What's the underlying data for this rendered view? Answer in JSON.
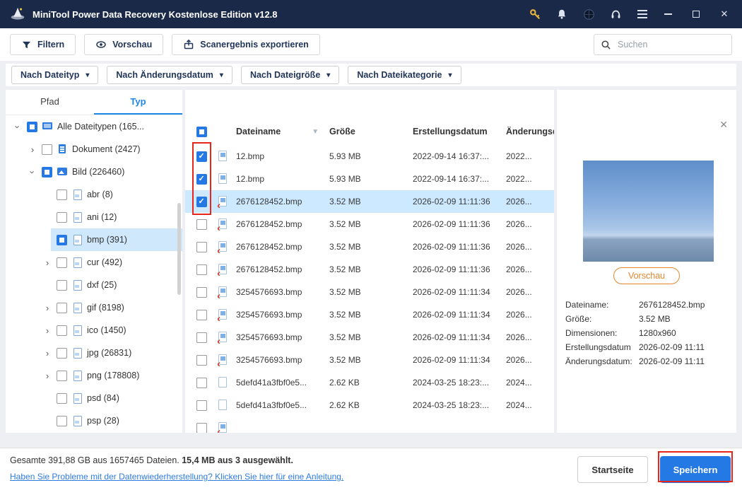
{
  "titlebar": {
    "title": "MiniTool Power Data Recovery Kostenlose Edition v12.8",
    "icons": [
      "key",
      "bell",
      "globe",
      "headset",
      "menu"
    ],
    "window_controls": [
      "minimize",
      "maximize",
      "close"
    ]
  },
  "toolbar": {
    "filtern": "Filtern",
    "vorschau": "Vorschau",
    "export": "Scanergebnis exportieren",
    "search_placeholder": "Suchen"
  },
  "filter_dropdowns": [
    "Nach Dateityp",
    "Nach Änderungsdatum",
    "Nach Dateigröße",
    "Nach Dateikategorie"
  ],
  "glyphs": {
    "caret_down": "▾",
    "sort_down": "▼",
    "close": "✕",
    "chevron": "›",
    "deleted_x": "✕"
  },
  "sidebar": {
    "tabs": [
      "Pfad",
      "Typ"
    ],
    "active_tab": "Typ",
    "tree": [
      {
        "label": "Alle Dateitypen (165...",
        "level": 0,
        "arrow": "down",
        "check": "partial",
        "icon": "all-types",
        "selected": false
      },
      {
        "label": "Dokument (2427)",
        "level": 1,
        "arrow": "right",
        "check": "unchecked",
        "icon": "document",
        "selected": false
      },
      {
        "label": "Bild (226460)",
        "level": 1,
        "arrow": "down",
        "check": "partial",
        "icon": "image",
        "selected": false
      },
      {
        "label": "abr (8)",
        "level": 2,
        "arrow": null,
        "check": "unchecked",
        "icon": "page",
        "selected": false
      },
      {
        "label": "ani (12)",
        "level": 2,
        "arrow": null,
        "check": "unchecked",
        "icon": "page",
        "selected": false
      },
      {
        "label": "bmp (391)",
        "level": 2,
        "arrow": null,
        "check": "partial",
        "icon": "page",
        "selected": true
      },
      {
        "label": "cur (492)",
        "level": 2,
        "arrow": "right",
        "check": "unchecked",
        "icon": "page",
        "selected": false
      },
      {
        "label": "dxf (25)",
        "level": 2,
        "arrow": null,
        "check": "unchecked",
        "icon": "page",
        "selected": false
      },
      {
        "label": "gif (8198)",
        "level": 2,
        "arrow": "right",
        "check": "unchecked",
        "icon": "page",
        "selected": false
      },
      {
        "label": "ico (1450)",
        "level": 2,
        "arrow": "right",
        "check": "unchecked",
        "icon": "page",
        "selected": false
      },
      {
        "label": "jpg (26831)",
        "level": 2,
        "arrow": "right",
        "check": "unchecked",
        "icon": "page",
        "selected": false
      },
      {
        "label": "png (178808)",
        "level": 2,
        "arrow": "right",
        "check": "unchecked",
        "icon": "page",
        "selected": false
      },
      {
        "label": "psd (84)",
        "level": 2,
        "arrow": null,
        "check": "unchecked",
        "icon": "page",
        "selected": false
      },
      {
        "label": "psp (28)",
        "level": 2,
        "arrow": null,
        "check": "unchecked",
        "icon": "page",
        "selected": false
      }
    ]
  },
  "table": {
    "headers": {
      "name": "Dateiname",
      "size": "Größe",
      "created": "Erstellungsdatum",
      "modified": "Änderungsdatum"
    },
    "header_check": "partial",
    "rows": [
      {
        "checked": true,
        "selected": false,
        "deleted": false,
        "icon": "img",
        "name": "12.bmp",
        "size": "5.93 MB",
        "created": "2022-09-14 16:37:...",
        "modified": "2022..."
      },
      {
        "checked": true,
        "selected": false,
        "deleted": false,
        "icon": "img",
        "name": "12.bmp",
        "size": "5.93 MB",
        "created": "2022-09-14 16:37:...",
        "modified": "2022..."
      },
      {
        "checked": true,
        "selected": true,
        "deleted": true,
        "icon": "img",
        "name": "2676128452.bmp",
        "size": "3.52 MB",
        "created": "2026-02-09 11:11:36",
        "modified": "2026..."
      },
      {
        "checked": false,
        "selected": false,
        "deleted": true,
        "icon": "img",
        "name": "2676128452.bmp",
        "size": "3.52 MB",
        "created": "2026-02-09 11:11:36",
        "modified": "2026..."
      },
      {
        "checked": false,
        "selected": false,
        "deleted": true,
        "icon": "img",
        "name": "2676128452.bmp",
        "size": "3.52 MB",
        "created": "2026-02-09 11:11:36",
        "modified": "2026..."
      },
      {
        "checked": false,
        "selected": false,
        "deleted": true,
        "icon": "img",
        "name": "2676128452.bmp",
        "size": "3.52 MB",
        "created": "2026-02-09 11:11:36",
        "modified": "2026..."
      },
      {
        "checked": false,
        "selected": false,
        "deleted": true,
        "icon": "img",
        "name": "3254576693.bmp",
        "size": "3.52 MB",
        "created": "2026-02-09 11:11:34",
        "modified": "2026..."
      },
      {
        "checked": false,
        "selected": false,
        "deleted": true,
        "icon": "img",
        "name": "3254576693.bmp",
        "size": "3.52 MB",
        "created": "2026-02-09 11:11:34",
        "modified": "2026..."
      },
      {
        "checked": false,
        "selected": false,
        "deleted": true,
        "icon": "img",
        "name": "3254576693.bmp",
        "size": "3.52 MB",
        "created": "2026-02-09 11:11:34",
        "modified": "2026..."
      },
      {
        "checked": false,
        "selected": false,
        "deleted": true,
        "icon": "img",
        "name": "3254576693.bmp",
        "size": "3.52 MB",
        "created": "2026-02-09 11:11:34",
        "modified": "2026..."
      },
      {
        "checked": false,
        "selected": false,
        "deleted": false,
        "icon": "plain",
        "name": "5defd41a3fbf0e5...",
        "size": "2.62 KB",
        "created": "2024-03-25 18:23:...",
        "modified": "2024..."
      },
      {
        "checked": false,
        "selected": false,
        "deleted": false,
        "icon": "plain",
        "name": "5defd41a3fbf0e5...",
        "size": "2.62 KB",
        "created": "2024-03-25 18:23:...",
        "modified": "2024..."
      },
      {
        "checked": false,
        "selected": false,
        "deleted": true,
        "icon": "img",
        "name": "",
        "size": "",
        "created": "",
        "modified": ""
      }
    ]
  },
  "preview": {
    "image_alt": "blue sky over sea photo preview",
    "button": "Vorschau",
    "details": [
      {
        "label": "Dateiname:",
        "value": "2676128452.bmp"
      },
      {
        "label": "Größe:",
        "value": "3.52 MB"
      },
      {
        "label": "Dimensionen:",
        "value": "1280x960"
      },
      {
        "label": "Erstellungsdatum",
        "value": "2026-02-09 11:11"
      },
      {
        "label": "Änderungsdatum:",
        "value": "2026-02-09 11:11"
      }
    ]
  },
  "footer": {
    "summary_prefix": "Gesamte 391,88 GB aus 1657465 Dateien.",
    "summary_bold": "15,4 MB aus 3 ausgewählt.",
    "help_link": "Haben Sie Probleme mit der Datenwiederherstellung? Klicken Sie hier für eine Anleitung.",
    "home_button": "Startseite",
    "save_button": "Speichern"
  },
  "colors": {
    "titlebar_bg": "#1a2947",
    "accent_blue": "#2479e5",
    "selected_row": "#cde9ff",
    "annotation_red": "#e8251a",
    "preview_orange": "#e2882f"
  }
}
